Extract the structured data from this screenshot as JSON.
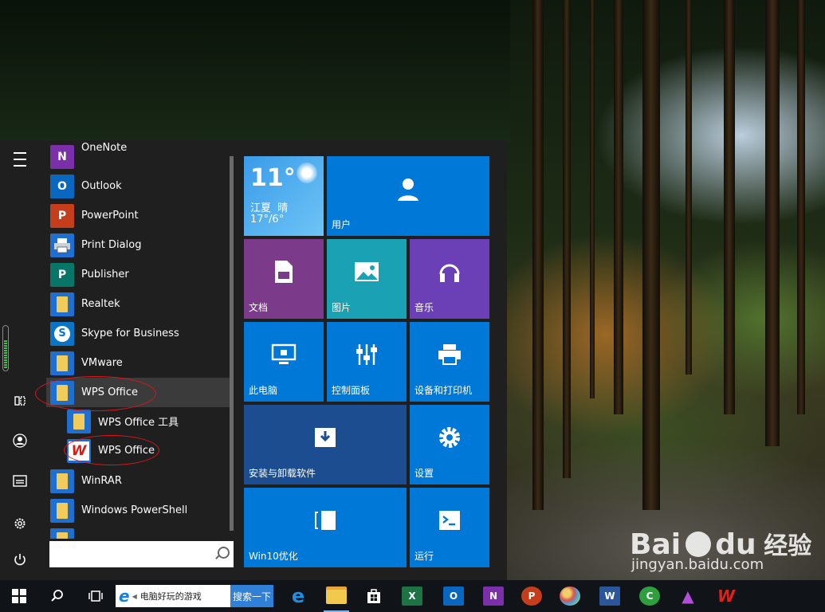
{
  "start_menu": {
    "apps": [
      {
        "label": "OneNote",
        "icon": "onenote-icon",
        "color": "#7b2fa8",
        "glyph": "N"
      },
      {
        "label": "Outlook",
        "icon": "outlook-icon",
        "color": "#0a67c0",
        "glyph": "O"
      },
      {
        "label": "PowerPoint",
        "icon": "powerpoint-icon",
        "color": "#c43e1c",
        "glyph": "P"
      },
      {
        "label": "Print Dialog",
        "icon": "printer-icon",
        "color": "#1f6fd1",
        "glyph": ""
      },
      {
        "label": "Publisher",
        "icon": "publisher-icon",
        "color": "#077568",
        "glyph": "P"
      },
      {
        "label": "Realtek",
        "icon": "folder-icon",
        "color": "#1f6fd1",
        "glyph": ""
      },
      {
        "label": "Skype for Business",
        "icon": "skype-icon",
        "color": "#0a75c6",
        "glyph": "S"
      },
      {
        "label": "VMware",
        "icon": "folder-icon",
        "color": "#1f6fd1",
        "glyph": ""
      },
      {
        "label": "WPS Office",
        "icon": "folder-icon",
        "color": "#1f6fd1",
        "glyph": ""
      },
      {
        "label": "WPS Office 工具",
        "icon": "folder-icon",
        "color": "#1f6fd1",
        "glyph": ""
      },
      {
        "label": "WPS Office",
        "icon": "wps-icon",
        "color": "#1f6fd1",
        "glyph": "W"
      },
      {
        "label": "WinRAR",
        "icon": "folder-icon",
        "color": "#1f6fd1",
        "glyph": ""
      },
      {
        "label": "Windows PowerShell",
        "icon": "folder-icon",
        "color": "#1f6fd1",
        "glyph": ""
      }
    ],
    "tiles": {
      "weather": {
        "temp": "11°",
        "city": "江夏",
        "condition": "晴",
        "range": "17°/6°"
      },
      "user": "用户",
      "documents": "文档",
      "pictures": "图片",
      "music": "音乐",
      "this_pc": "此电脑",
      "control_panel": "控制面板",
      "devices_printers": "设备和打印机",
      "install_uninstall": "安装与卸载软件",
      "settings": "设置",
      "win10_optimize": "Win10优化",
      "run": "运行"
    }
  },
  "taskbar": {
    "browser_search_text": "电脑好玩的游戏",
    "search_button": "搜索一下",
    "apps": [
      "edge-icon",
      "file-explorer-icon",
      "store-icon",
      "excel-icon",
      "outlook-icon",
      "onenote-icon",
      "powerpoint-icon",
      "paint-icon",
      "word-icon",
      "green-app-icon",
      "purple-app-icon",
      "wps-icon"
    ]
  },
  "watermark": {
    "brand": "Bai",
    "brand2": "du",
    "cn": "经验",
    "url": "jingyan.baidu.com"
  },
  "colors": {
    "tile_blue": "#0078d7",
    "tile_purple": "#7b3a8a",
    "tile_teal": "#1aa2b4",
    "tile_violet": "#6b3fb5",
    "tile_navy": "#1c4d91",
    "highlight_ellipse": "#e0151b"
  }
}
